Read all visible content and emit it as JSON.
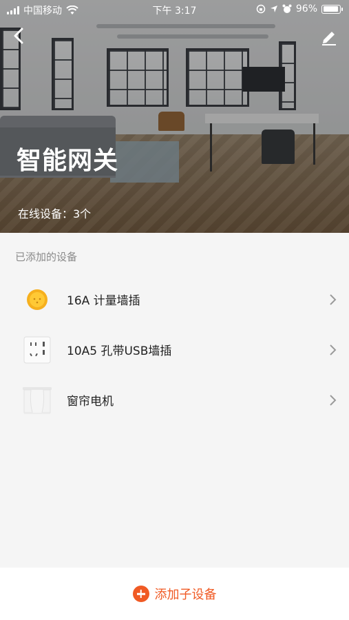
{
  "status_bar": {
    "carrier": "中国移动",
    "time": "下午 3:17",
    "battery": "96%",
    "battery_level": 0.96
  },
  "header": {
    "title": "智能网关",
    "subtitle": "在线设备：3个"
  },
  "section": {
    "title": "已添加的设备"
  },
  "devices": [
    {
      "name": "16A 计量墙插",
      "icon": "orange-socket-icon"
    },
    {
      "name": "10A5 孔带USB墙插",
      "icon": "usb-wall-socket-icon"
    },
    {
      "name": "窗帘电机",
      "icon": "curtain-motor-icon"
    }
  ],
  "footer": {
    "add_label": "添加子设备"
  },
  "colors": {
    "accent": "#f05a24"
  }
}
